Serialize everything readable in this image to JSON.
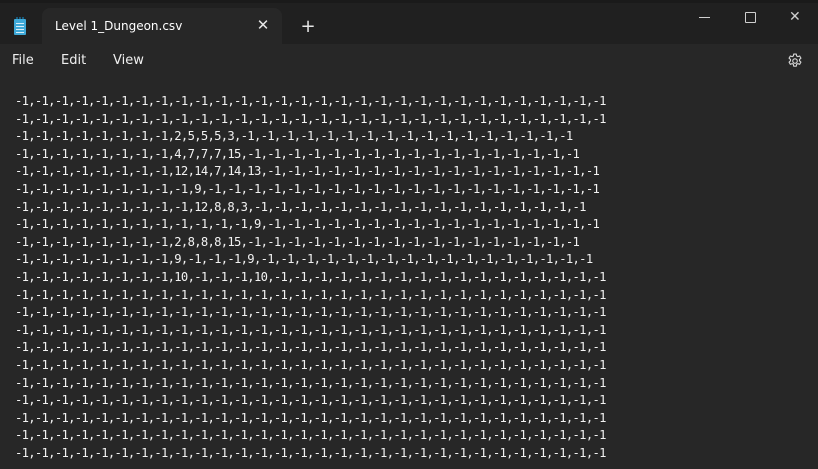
{
  "window": {
    "tab_title": "Level 1_Dungeon.csv",
    "tab_close_glyph": "✕",
    "new_tab_glyph": "+",
    "close_glyph": "✕"
  },
  "menu": {
    "file": "File",
    "edit": "Edit",
    "view": "View"
  },
  "icons": {
    "app": "notepad-icon",
    "settings": "gear-icon"
  },
  "editor": {
    "lines": [
      "-1,-1,-1,-1,-1,-1,-1,-1,-1,-1,-1,-1,-1,-1,-1,-1,-1,-1,-1,-1,-1,-1,-1,-1,-1,-1,-1,-1,-1,-1",
      "-1,-1,-1,-1,-1,-1,-1,-1,-1,-1,-1,-1,-1,-1,-1,-1,-1,-1,-1,-1,-1,-1,-1,-1,-1,-1,-1,-1,-1,-1",
      "-1,-1,-1,-1,-1,-1,-1,-1,2,5,5,5,3,-1,-1,-1,-1,-1,-1,-1,-1,-1,-1,-1,-1,-1,-1,-1,-1,-1",
      "-1,-1,-1,-1,-1,-1,-1,-1,4,7,7,7,15,-1,-1,-1,-1,-1,-1,-1,-1,-1,-1,-1,-1,-1,-1,-1,-1,-1",
      "-1,-1,-1,-1,-1,-1,-1,-1,12,14,7,14,13,-1,-1,-1,-1,-1,-1,-1,-1,-1,-1,-1,-1,-1,-1,-1,-1,-1",
      "-1,-1,-1,-1,-1,-1,-1,-1,-1,9,-1,-1,-1,-1,-1,-1,-1,-1,-1,-1,-1,-1,-1,-1,-1,-1,-1,-1,-1,-1",
      "-1,-1,-1,-1,-1,-1,-1,-1,-1,12,8,8,3,-1,-1,-1,-1,-1,-1,-1,-1,-1,-1,-1,-1,-1,-1,-1,-1,-1",
      "-1,-1,-1,-1,-1,-1,-1,-1,-1,-1,-1,-1,9,-1,-1,-1,-1,-1,-1,-1,-1,-1,-1,-1,-1,-1,-1,-1,-1,-1",
      "-1,-1,-1,-1,-1,-1,-1,-1,2,8,8,8,15,-1,-1,-1,-1,-1,-1,-1,-1,-1,-1,-1,-1,-1,-1,-1,-1,-1",
      "-1,-1,-1,-1,-1,-1,-1,-1,9,-1,-1,-1,9,-1,-1,-1,-1,-1,-1,-1,-1,-1,-1,-1,-1,-1,-1,-1,-1,-1",
      "-1,-1,-1,-1,-1,-1,-1,-1,10,-1,-1,-1,10,-1,-1,-1,-1,-1,-1,-1,-1,-1,-1,-1,-1,-1,-1,-1,-1,-1",
      "-1,-1,-1,-1,-1,-1,-1,-1,-1,-1,-1,-1,-1,-1,-1,-1,-1,-1,-1,-1,-1,-1,-1,-1,-1,-1,-1,-1,-1,-1",
      "-1,-1,-1,-1,-1,-1,-1,-1,-1,-1,-1,-1,-1,-1,-1,-1,-1,-1,-1,-1,-1,-1,-1,-1,-1,-1,-1,-1,-1,-1",
      "-1,-1,-1,-1,-1,-1,-1,-1,-1,-1,-1,-1,-1,-1,-1,-1,-1,-1,-1,-1,-1,-1,-1,-1,-1,-1,-1,-1,-1,-1",
      "-1,-1,-1,-1,-1,-1,-1,-1,-1,-1,-1,-1,-1,-1,-1,-1,-1,-1,-1,-1,-1,-1,-1,-1,-1,-1,-1,-1,-1,-1",
      "-1,-1,-1,-1,-1,-1,-1,-1,-1,-1,-1,-1,-1,-1,-1,-1,-1,-1,-1,-1,-1,-1,-1,-1,-1,-1,-1,-1,-1,-1",
      "-1,-1,-1,-1,-1,-1,-1,-1,-1,-1,-1,-1,-1,-1,-1,-1,-1,-1,-1,-1,-1,-1,-1,-1,-1,-1,-1,-1,-1,-1",
      "-1,-1,-1,-1,-1,-1,-1,-1,-1,-1,-1,-1,-1,-1,-1,-1,-1,-1,-1,-1,-1,-1,-1,-1,-1,-1,-1,-1,-1,-1",
      "-1,-1,-1,-1,-1,-1,-1,-1,-1,-1,-1,-1,-1,-1,-1,-1,-1,-1,-1,-1,-1,-1,-1,-1,-1,-1,-1,-1,-1,-1",
      "-1,-1,-1,-1,-1,-1,-1,-1,-1,-1,-1,-1,-1,-1,-1,-1,-1,-1,-1,-1,-1,-1,-1,-1,-1,-1,-1,-1,-1,-1",
      "-1,-1,-1,-1,-1,-1,-1,-1,-1,-1,-1,-1,-1,-1,-1,-1,-1,-1,-1,-1,-1,-1,-1,-1,-1,-1,-1,-1,-1,-1"
    ]
  }
}
